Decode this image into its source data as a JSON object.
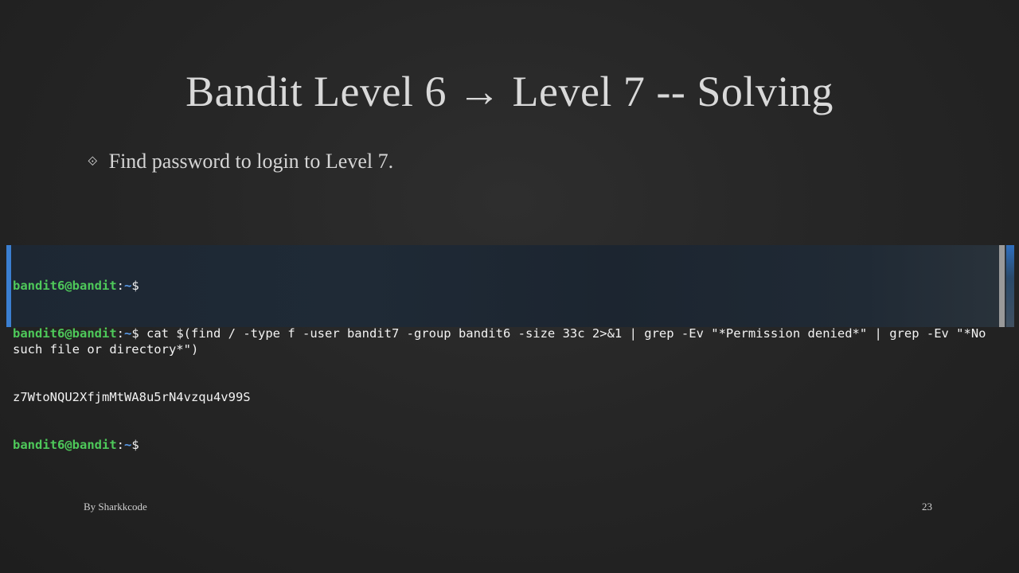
{
  "slide": {
    "title": "Bandit Level 6 → Level 7 -- Solving",
    "bullets": [
      {
        "icon": "diamond-bullet-icon",
        "text": "Find password to login to Level 7."
      }
    ],
    "footer": {
      "author": "By Sharkkcode",
      "page_number": "23"
    }
  },
  "terminal": {
    "prompt_user": "bandit6@bandit",
    "prompt_sep": ":",
    "prompt_path": "~",
    "prompt_symbol": "$",
    "lines": [
      {
        "type": "prompt",
        "command": ""
      },
      {
        "type": "prompt",
        "command": " cat $(find / -type f -user bandit7 -group bandit6 -size 33c 2>&1 | grep -Ev \"*Permission denied*\" | grep -Ev \"*No such file or directory*\")"
      },
      {
        "type": "output",
        "text": "z7WtoNQU2XfjmMtWA8u5rN4vzqu4v99S"
      },
      {
        "type": "prompt",
        "command": ""
      }
    ]
  },
  "colors": {
    "prompt_user": "#4ec95a",
    "prompt_path": "#5a9bea",
    "title_text": "#d9d9d9",
    "terminal_bg": "#1f2a36"
  }
}
